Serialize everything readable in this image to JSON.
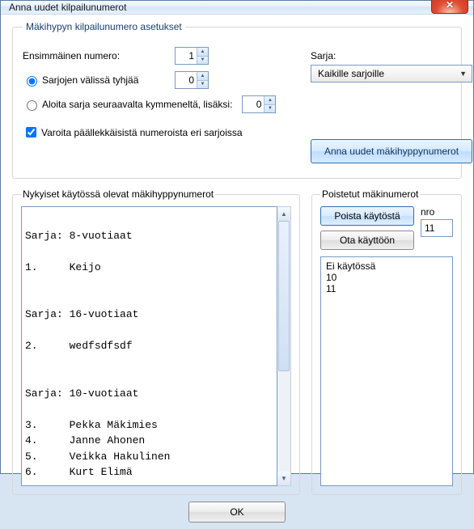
{
  "window": {
    "title": "Anna uudet kilpailunumerot"
  },
  "settings": {
    "legend": "Mäkihypyn kilpailunumero asetukset",
    "first_number_label": "Ensimmäinen numero:",
    "first_number_value": "1",
    "gap_label": "Sarjojen välissä tyhjää",
    "gap_value": "0",
    "next_ten_label": "Aloita sarja seuraavalta kymmeneltä, lisäksi:",
    "next_ten_value": "0",
    "warn_label": "Varoita päällekkäisistä numeroista eri sarjoissa",
    "sarja_label": "Sarja:",
    "sarja_value": "Kaikille sarjoille",
    "assign_button": "Anna uudet mäkihyppynumerot"
  },
  "current": {
    "legend": "Nykyiset käytössä olevat mäkihyppynumerot",
    "text": "\nSarja: 8-vuotiaat\n\n1.     Keijo\n\n\nSarja: 16-vuotiaat\n\n2.     wedfsdfsdf\n\n\nSarja: 10-vuotiaat\n\n3.     Pekka Mäkimies\n4.     Janne Ahonen\n5.     Veikka Hakulinen\n6.     Kurt Elimä"
  },
  "removed": {
    "legend": "Poistetut mäkinumerot",
    "remove_btn": "Poista käytöstä",
    "restore_btn": "Ota käyttöön",
    "nro_label": "nro",
    "nro_value": "11",
    "list_header": "Ei käytössä",
    "items": [
      "10",
      "11"
    ]
  },
  "ok_label": "OK"
}
